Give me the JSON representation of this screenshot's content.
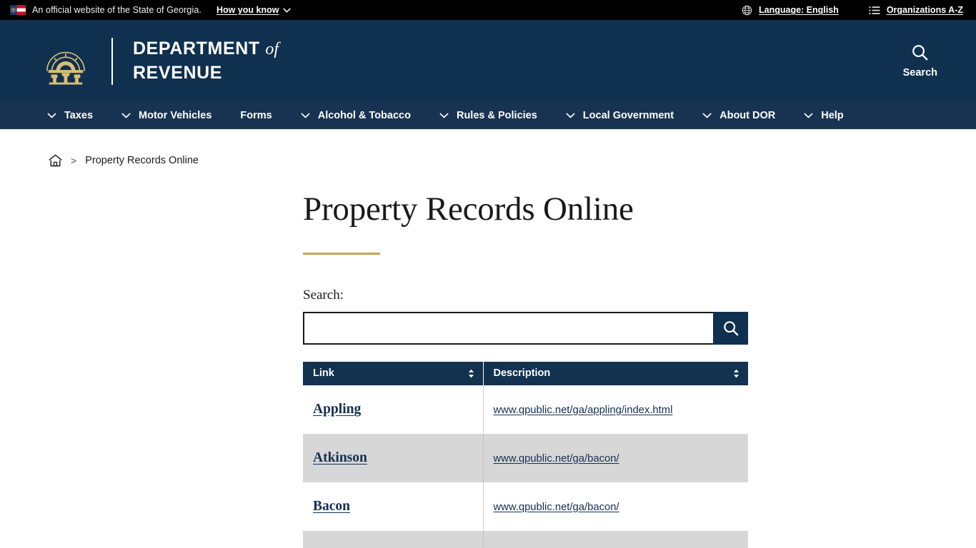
{
  "gov_bar": {
    "flag_icon": "georgia-state-flag-icon",
    "notice": "An official website of the State of Georgia.",
    "how_you_know": "How you know",
    "chevron_icon": "chevron-down-icon",
    "language": {
      "icon": "globe-icon",
      "label": "Language: English"
    },
    "organizations": {
      "icon": "list-icon",
      "label": "Organizations A-Z"
    }
  },
  "masthead": {
    "seal_icon": "georgia-capitol-seal-icon",
    "title_line1": "DEPARTMENT",
    "title_of": "of",
    "title_line2": "REVENUE",
    "search": {
      "icon": "search-icon",
      "label": "Search"
    },
    "bg_color": "#10304f"
  },
  "nav": {
    "bg_color": "#173351",
    "items": [
      {
        "label": "Taxes",
        "has_dropdown": true
      },
      {
        "label": "Motor Vehicles",
        "has_dropdown": true
      },
      {
        "label": "Forms",
        "has_dropdown": false
      },
      {
        "label": "Alcohol & Tobacco",
        "has_dropdown": true
      },
      {
        "label": "Rules & Policies",
        "has_dropdown": true
      },
      {
        "label": "Local Government",
        "has_dropdown": true
      },
      {
        "label": "About DOR",
        "has_dropdown": true
      },
      {
        "label": "Help",
        "has_dropdown": true
      }
    ]
  },
  "breadcrumb": {
    "home_icon": "home-icon",
    "separator": ">",
    "current": "Property Records Online"
  },
  "main": {
    "page_title": "Property Records Online",
    "rule_color": "#c7a65a",
    "search": {
      "label": "Search:",
      "value": "",
      "placeholder": "",
      "button_icon": "search-icon"
    },
    "table": {
      "columns": [
        {
          "label": "Link",
          "sort_icon": "sort-updown-icon"
        },
        {
          "label": "Description",
          "sort_icon": "sort-updown-icon"
        }
      ],
      "rows": [
        {
          "link": "Appling",
          "description": "www.qpublic.net/ga/appling/index.html",
          "alt": false
        },
        {
          "link": "Atkinson",
          "description": "www.qpublic.net/ga/bacon/",
          "alt": true
        },
        {
          "link": "Bacon",
          "description": "www.qpublic.net/ga/bacon/",
          "alt": false
        },
        {
          "link": "",
          "description": "",
          "alt": true
        }
      ]
    }
  }
}
